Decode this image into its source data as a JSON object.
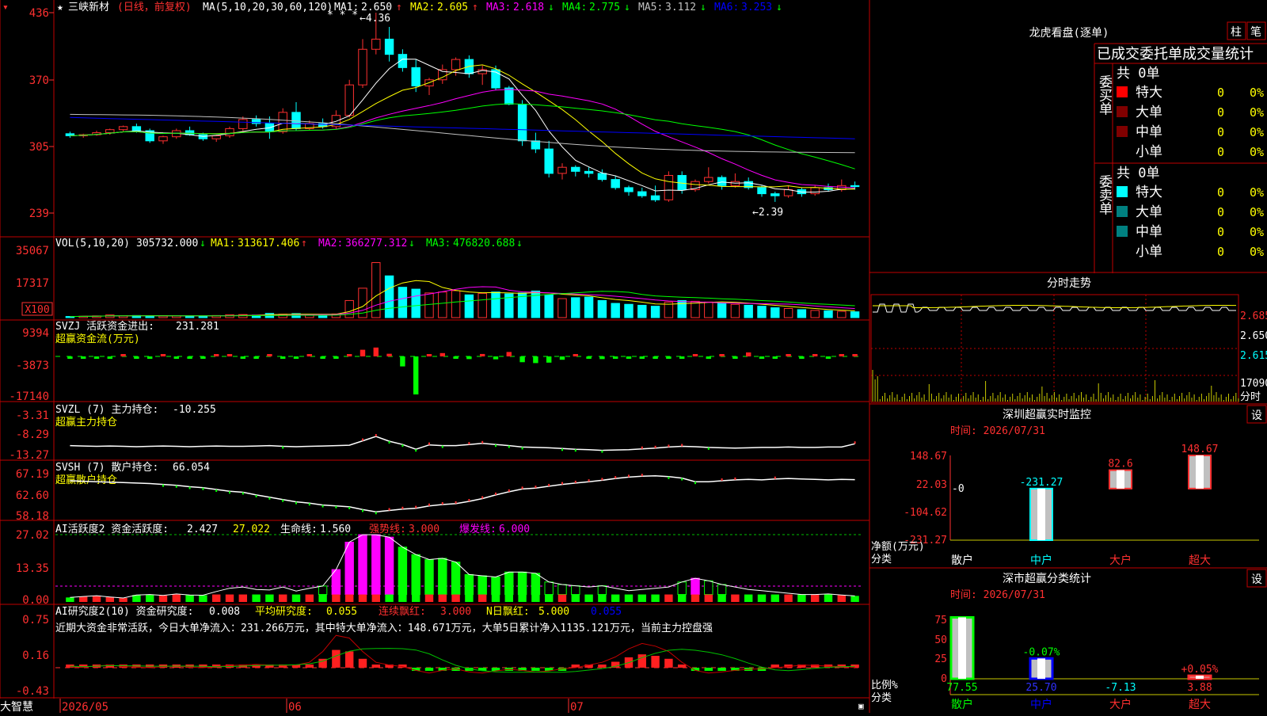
{
  "stock": {
    "name": "三峡新材",
    "period_tag": "(日线，前复权)",
    "ma_title": "MA(5,10,20,30,60,120)",
    "ma_values": [
      {
        "label": "MA1:",
        "value": "2.650",
        "arrow": "↑",
        "color": "#ffffff"
      },
      {
        "label": "MA2:",
        "value": "2.605",
        "arrow": "↑",
        "color": "#ffff00"
      },
      {
        "label": "MA3:",
        "value": "2.618",
        "arrow": "↓",
        "color": "#ff00ff"
      },
      {
        "label": "MA4:",
        "value": "2.775",
        "arrow": "↓",
        "color": "#00ff00"
      },
      {
        "label": "MA5:",
        "value": "3.112",
        "arrow": "↓",
        "color": "#c0c0c0"
      },
      {
        "label": "MA6:",
        "value": "3.253",
        "arrow": "↓",
        "color": "#0000ff"
      }
    ],
    "high_note": "←4.36",
    "low_note": "←2.39",
    "y_ticks": [
      "436",
      "370",
      "305",
      "239"
    ]
  },
  "volume": {
    "title": "VOL(5,10,20)",
    "value": "305732.000",
    "mas": [
      {
        "label": "MA1:",
        "value": "313617.406",
        "arrow": "↑",
        "color": "#ffff00"
      },
      {
        "label": "MA2:",
        "value": "366277.312",
        "arrow": "↓",
        "color": "#ff00ff"
      },
      {
        "label": "MA3:",
        "value": "476820.688",
        "arrow": "↓",
        "color": "#00ff00"
      }
    ],
    "y_ticks": [
      "35067",
      "17317"
    ],
    "unit": "X100"
  },
  "svzj": {
    "title": "SVZJ  活跃资金进出:",
    "value": "231.281",
    "subtitle": "超赢资金流(万元)",
    "y_ticks": [
      "9394",
      "-3873",
      "-17140"
    ]
  },
  "svzl": {
    "title": "SVZL (7) 主力持仓:",
    "value": "-10.255",
    "subtitle": "超赢主力持仓",
    "y_ticks": [
      "-3.31",
      "-8.29",
      "-13.27"
    ]
  },
  "svsh": {
    "title": "SVSH (7) 散户持仓:",
    "value": "66.054",
    "subtitle": "超赢散户持仓",
    "y_ticks": [
      "67.19",
      "62.60",
      "58.18"
    ]
  },
  "ai_active": {
    "title": "AI活跃度2 资金活跃度:",
    "value": "2.427",
    "v2": "27.022",
    "life_label": "生命线:",
    "life_value": "1.560",
    "strong_label": "强势线:",
    "strong_value": "3.000",
    "burst_label": "爆发线:",
    "burst_value": "6.000",
    "y_ticks": [
      "27.02",
      "13.35",
      "0.00"
    ]
  },
  "ai_research": {
    "title": "AI研究度2(10) 资金研究度:",
    "value": "0.008",
    "avg_label": "平均研究度:",
    "avg_value": "0.055",
    "red_label": "连续飘红:",
    "red_value": "3.000",
    "nred_label": "N日飘红:",
    "nred_value": "5.000",
    "last_value": "0.055",
    "comment": "近期大资金非常活跃，今日大单净流入：231.266万元，其中特大单净流入：148.671万元，大单5日累计净入1135.121万元，当前主力控盘强",
    "y_ticks": [
      "0.75",
      "0.16",
      "-0.43"
    ]
  },
  "xaxis": {
    "labels": [
      "2026/05",
      "06",
      "07"
    ],
    "brand": "大智慧"
  },
  "dragon": {
    "title": "龙虎看盘(逐单)",
    "btn1": "柱",
    "btn2": "笔",
    "header": "已成交委托单成交量统计",
    "buy_label": "委买单",
    "sell_label": "委卖单",
    "total_text": "共 0单",
    "rows": [
      {
        "label": "特大",
        "value": "0",
        "pct": "0%"
      },
      {
        "label": "大单",
        "value": "0",
        "pct": "0%"
      },
      {
        "label": "中单",
        "value": "0",
        "pct": "0%"
      },
      {
        "label": "小单",
        "value": "0",
        "pct": "0%"
      }
    ]
  },
  "intraday": {
    "title": "分时走势",
    "y_ticks": [
      "2.685",
      "2.650",
      "2.615"
    ],
    "vol_tick": "17090",
    "footer": "分时"
  },
  "monitor": {
    "title": "深圳超赢实时监控",
    "btn": "设",
    "time": "时间: 2026/07/31",
    "y_ticks": [
      "148.67",
      "22.03",
      "-104.62",
      "-231.27"
    ],
    "zero_label": "-0",
    "ylabel": "净额(万元)",
    "xlabel": "分类",
    "categories": [
      "散户",
      "中户",
      "大户",
      "超大"
    ],
    "values": [
      0,
      -231.27,
      82.6,
      148.67
    ],
    "value_labels": [
      "",
      "-231.27",
      "82.6",
      "148.67"
    ]
  },
  "classify": {
    "title": "深市超赢分类统计",
    "btn": "设",
    "time": "时间: 2026/07/31",
    "y_ticks": [
      "75",
      "50",
      "25",
      "0"
    ],
    "ylabel": "比例%",
    "xlabel": "分类",
    "categories": [
      "散户",
      "中户",
      "大户",
      "超大"
    ],
    "values": [
      77.55,
      25.7,
      -7.13,
      3.88
    ],
    "value_labels": [
      "77.55",
      "25.70",
      "-7.13",
      "3.88"
    ],
    "change_labels": [
      "",
      "-0.07%",
      "",
      "+0.05%"
    ]
  },
  "chart_data": {
    "type": "candlestick",
    "title": "三峡新材 (日线，前复权)",
    "xlabel": "",
    "ylabel": "",
    "x_labels": [
      "2026/05",
      "06",
      "07"
    ],
    "ylim": [
      2.39,
      4.36
    ],
    "ohlc": [
      [
        3.17,
        3.19,
        3.13,
        3.15
      ],
      [
        3.15,
        3.17,
        3.13,
        3.16
      ],
      [
        3.16,
        3.2,
        3.15,
        3.18
      ],
      [
        3.18,
        3.22,
        3.16,
        3.21
      ],
      [
        3.21,
        3.25,
        3.19,
        3.24
      ],
      [
        3.24,
        3.27,
        3.18,
        3.2
      ],
      [
        3.2,
        3.22,
        3.08,
        3.1
      ],
      [
        3.1,
        3.15,
        3.07,
        3.14
      ],
      [
        3.14,
        3.22,
        3.12,
        3.2
      ],
      [
        3.2,
        3.24,
        3.15,
        3.16
      ],
      [
        3.16,
        3.18,
        3.1,
        3.12
      ],
      [
        3.12,
        3.16,
        3.09,
        3.15
      ],
      [
        3.15,
        3.24,
        3.13,
        3.22
      ],
      [
        3.22,
        3.34,
        3.2,
        3.31
      ],
      [
        3.31,
        3.35,
        3.24,
        3.27
      ],
      [
        3.27,
        3.34,
        3.12,
        3.19
      ],
      [
        3.19,
        3.42,
        3.17,
        3.38
      ],
      [
        3.38,
        3.48,
        3.2,
        3.22
      ],
      [
        3.22,
        3.3,
        3.2,
        3.27
      ],
      [
        3.27,
        3.32,
        3.22,
        3.24
      ],
      [
        3.24,
        3.4,
        3.22,
        3.35
      ],
      [
        3.35,
        3.7,
        3.33,
        3.65
      ],
      [
        3.65,
        4.1,
        3.62,
        4.0
      ],
      [
        4.0,
        4.36,
        3.95,
        4.1
      ],
      [
        4.1,
        4.22,
        3.88,
        3.95
      ],
      [
        3.95,
        4.0,
        3.78,
        3.82
      ],
      [
        3.82,
        3.9,
        3.58,
        3.64
      ],
      [
        3.64,
        3.72,
        3.55,
        3.7
      ],
      [
        3.7,
        3.85,
        3.66,
        3.8
      ],
      [
        3.8,
        3.92,
        3.74,
        3.9
      ],
      [
        3.9,
        3.94,
        3.72,
        3.76
      ],
      [
        3.76,
        3.84,
        3.65,
        3.8
      ],
      [
        3.8,
        3.84,
        3.6,
        3.62
      ],
      [
        3.62,
        3.64,
        3.45,
        3.46
      ],
      [
        3.46,
        3.5,
        3.05,
        3.1
      ],
      [
        3.1,
        3.18,
        2.98,
        3.02
      ],
      [
        3.02,
        3.1,
        2.74,
        2.78
      ],
      [
        2.78,
        2.88,
        2.72,
        2.84
      ],
      [
        2.84,
        2.86,
        2.75,
        2.8
      ],
      [
        2.8,
        2.84,
        2.74,
        2.78
      ],
      [
        2.78,
        2.82,
        2.7,
        2.72
      ],
      [
        2.72,
        2.76,
        2.62,
        2.64
      ],
      [
        2.64,
        2.66,
        2.56,
        2.6
      ],
      [
        2.6,
        2.64,
        2.54,
        2.56
      ],
      [
        2.56,
        2.66,
        2.5,
        2.52
      ],
      [
        2.52,
        2.8,
        2.5,
        2.76
      ],
      [
        2.76,
        2.8,
        2.58,
        2.62
      ],
      [
        2.62,
        2.72,
        2.6,
        2.7
      ],
      [
        2.7,
        2.84,
        2.68,
        2.74
      ],
      [
        2.74,
        2.76,
        2.62,
        2.66
      ],
      [
        2.66,
        2.78,
        2.64,
        2.7
      ],
      [
        2.7,
        2.74,
        2.62,
        2.64
      ],
      [
        2.64,
        2.66,
        2.55,
        2.58
      ],
      [
        2.58,
        2.6,
        2.5,
        2.56
      ],
      [
        2.56,
        2.66,
        2.54,
        2.62
      ],
      [
        2.62,
        2.64,
        2.55,
        2.58
      ],
      [
        2.58,
        2.66,
        2.56,
        2.64
      ],
      [
        2.64,
        2.68,
        2.6,
        2.62
      ],
      [
        2.62,
        2.72,
        2.6,
        2.66
      ],
      [
        2.66,
        2.7,
        2.62,
        2.65
      ]
    ],
    "series": [
      {
        "name": "MA1",
        "color": "#ffffff"
      },
      {
        "name": "MA2",
        "color": "#ffff00"
      },
      {
        "name": "MA3",
        "color": "#ff00ff"
      },
      {
        "name": "MA4",
        "color": "#00ff00"
      },
      {
        "name": "MA5",
        "color": "#c0c0c0"
      },
      {
        "name": "MA6",
        "color": "#0000ff"
      }
    ],
    "volume": [
      60,
      70,
      90,
      140,
      90,
      110,
      100,
      80,
      95,
      90,
      85,
      110,
      150,
      160,
      130,
      220,
      180,
      210,
      140,
      150,
      190,
      900,
      1550,
      2900,
      2200,
      1600,
      1500,
      1300,
      1350,
      1420,
      1200,
      1280,
      1350,
      1250,
      1300,
      1400,
      1200,
      1000,
      1050,
      1080,
      900,
      750,
      700,
      650,
      600,
      820,
      900,
      860,
      820,
      760,
      700,
      650,
      600,
      520,
      480,
      420,
      380,
      360,
      330,
      306
    ],
    "flow": [
      -200,
      -100,
      -50,
      -30,
      100,
      -300,
      -700,
      200,
      -100,
      -150,
      -300,
      200,
      300,
      -200,
      -400,
      300,
      -600,
      -400,
      200,
      -100,
      -300,
      400,
      3000,
      4000,
      1200,
      -4500,
      -17140,
      900,
      1500,
      -700,
      -1200,
      1100,
      -1300,
      2000,
      -2600,
      -3000,
      -2800,
      -1500,
      700,
      -900,
      -1200,
      -500,
      -600,
      -700,
      -1100,
      -900,
      -300,
      500,
      -1100,
      800,
      -600,
      1800,
      -400,
      -800,
      900,
      -400,
      500,
      -300,
      600,
      231
    ],
    "zl": [
      -10.8,
      -10.9,
      -11.0,
      -10.9,
      -11.0,
      -11.1,
      -11.0,
      -10.9,
      -11.0,
      -11.1,
      -11.0,
      -10.9,
      -11.0,
      -11.0,
      -10.9,
      -10.8,
      -11.0,
      -11.1,
      -11.0,
      -10.9,
      -10.8,
      -10.7,
      -9.5,
      -8.3,
      -9.6,
      -10.5,
      -11.8,
      -10.6,
      -10.8,
      -10.8,
      -10.5,
      -10.2,
      -10.5,
      -10.8,
      -11.2,
      -11.3,
      -11.4,
      -11.6,
      -11.8,
      -11.9,
      -12.1,
      -12.0,
      -11.9,
      -11.7,
      -11.5,
      -11.2,
      -11.0,
      -11.1,
      -11.3,
      -11.4,
      -11.5,
      -11.4,
      -11.3,
      -11.3,
      -11.2,
      -11.3,
      -11.3,
      -11.2,
      -11.2,
      -10.3
    ],
    "sh": [
      65.8,
      65.7,
      65.6,
      65.5,
      65.4,
      65.3,
      65.2,
      65.0,
      64.8,
      64.5,
      64.3,
      63.9,
      63.5,
      63.3,
      62.7,
      62.2,
      61.7,
      61.2,
      60.9,
      60.5,
      60.3,
      60.1,
      59.5,
      59.0,
      59.3,
      59.6,
      59.8,
      60.3,
      60.6,
      60.8,
      61.3,
      61.9,
      62.7,
      63.4,
      64.0,
      64.2,
      64.6,
      65.0,
      65.3,
      65.6,
      65.9,
      66.3,
      66.6,
      66.8,
      66.9,
      66.7,
      66.4,
      65.6,
      65.6,
      65.8,
      66.0,
      66.1,
      66.0,
      66.2,
      66.3,
      66.2,
      66.1,
      66.0,
      66.1,
      66.05
    ],
    "activity": [
      1.8,
      2.2,
      2.5,
      2.0,
      1.6,
      2.8,
      3.0,
      2.6,
      3.2,
      2.8,
      2.7,
      4.2,
      5.5,
      6.0,
      5.0,
      4.8,
      6.0,
      4.4,
      5.5,
      6.4,
      13.0,
      24.0,
      27.0,
      27.0,
      26.0,
      22.0,
      19.0,
      17.0,
      17.5,
      16.0,
      11.0,
      10.5,
      10.0,
      12.0,
      12.0,
      11.5,
      8.0,
      7.0,
      6.5,
      6.0,
      6.5,
      5.5,
      4.5,
      5.0,
      5.5,
      6.0,
      8.0,
      9.5,
      8.5,
      7.0,
      6.0,
      5.0,
      4.5,
      4.0,
      3.5,
      3.0,
      3.0,
      3.2,
      2.8,
      2.43
    ],
    "research": [
      0.02,
      0.01,
      0.03,
      0.05,
      0.02,
      0.01,
      0.0,
      0.02,
      0.03,
      0.01,
      0.0,
      0.02,
      0.04,
      0.05,
      0.06,
      0.05,
      0.04,
      0.05,
      0.1,
      0.3,
      0.6,
      0.55,
      0.3,
      0.1,
      0.05,
      0.02,
      -0.05,
      -0.1,
      -0.05,
      -0.02,
      -0.08,
      -0.1,
      -0.06,
      -0.03,
      -0.05,
      -0.08,
      -0.06,
      -0.02,
      0.0,
      0.05,
      0.1,
      0.2,
      0.35,
      0.45,
      0.4,
      0.3,
      0.1,
      -0.05,
      -0.1,
      -0.08,
      -0.05,
      -0.03,
      -0.02,
      0.0,
      0.02,
      0.05,
      0.04,
      0.03,
      0.02,
      0.008
    ]
  }
}
